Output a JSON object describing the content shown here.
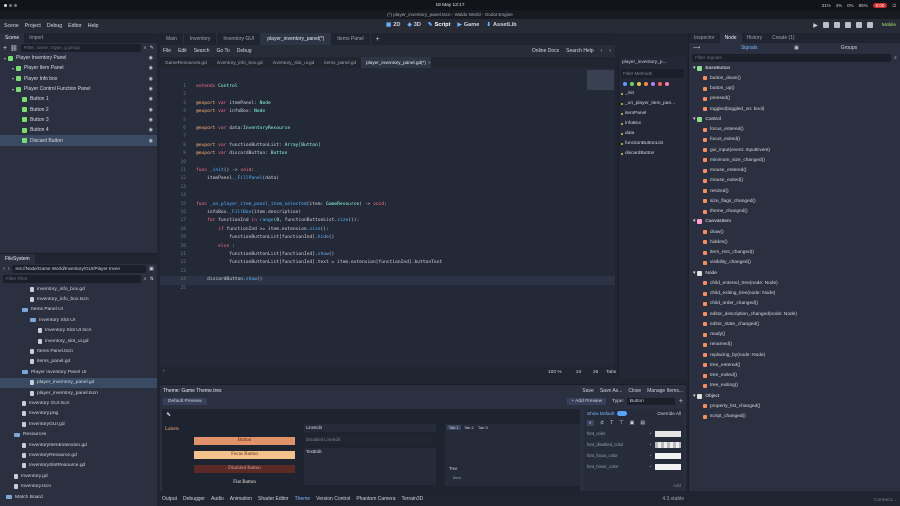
{
  "system": {
    "date_time": "18 May 13:17",
    "battery": "31%",
    "mem": "4%",
    "cpu": "0%",
    "vol": "85%",
    "rec": "0:00"
  },
  "window_title": "(*) player_inventory_panel.tscn - Waldo World - Godot Engine",
  "menu": [
    "Scene",
    "Project",
    "Debug",
    "Editor",
    "Help"
  ],
  "workspaces": [
    "2D",
    "3D",
    "Script",
    "Game",
    "AssetLib"
  ],
  "renderer": "Mobile",
  "scene_dock": {
    "tabs": [
      "Scene",
      "Import"
    ],
    "filter_placeholder": "Filter: name, t:type, g:group",
    "nodes": [
      {
        "label": "Player Inventory Panel",
        "color": "#79e06e",
        "indent": 0
      },
      {
        "label": "Player Item Panel",
        "color": "#79e06e",
        "indent": 1
      },
      {
        "label": "Player Info box",
        "color": "#79e06e",
        "indent": 1
      },
      {
        "label": "Player Control Function Panel",
        "color": "#79e06e",
        "indent": 1
      },
      {
        "label": "Button 1",
        "color": "#79e06e",
        "indent": 2
      },
      {
        "label": "Button 2",
        "color": "#79e06e",
        "indent": 2
      },
      {
        "label": "Button 3",
        "color": "#79e06e",
        "indent": 2
      },
      {
        "label": "Button 4",
        "color": "#79e06e",
        "indent": 2
      },
      {
        "label": "Discard Button",
        "color": "#79e06e",
        "indent": 2
      }
    ]
  },
  "filesystem": {
    "title": "FileSystem",
    "path": "res://Node/Game World/Inventory/GUI/Player Inven",
    "filter_placeholder": "Filter Files",
    "items": [
      {
        "label": "inventory_info_box.gd",
        "kind": "file",
        "indent": 3
      },
      {
        "label": "Inventory_info_box.tscn",
        "kind": "file",
        "indent": 3
      },
      {
        "label": "Items Panel UI",
        "kind": "folder",
        "indent": 2
      },
      {
        "label": "Inventory Slot UI",
        "kind": "folder",
        "indent": 3
      },
      {
        "label": "Inventory Slot UI.tscn",
        "kind": "file",
        "indent": 4
      },
      {
        "label": "inventory_slot_ui.gd",
        "kind": "file",
        "indent": 4
      },
      {
        "label": "Items Panel.tscn",
        "kind": "file",
        "indent": 3
      },
      {
        "label": "items_panel.gd",
        "kind": "file",
        "indent": 3
      },
      {
        "label": "Player Inventory Panel UI",
        "kind": "folder",
        "indent": 2
      },
      {
        "label": "player_inventory_panel.gd",
        "kind": "file",
        "indent": 3
      },
      {
        "label": "player_inventory_panel.tscn",
        "kind": "file",
        "indent": 3
      },
      {
        "label": "Inventory GUI.tscn",
        "kind": "file",
        "indent": 2
      },
      {
        "label": "Inventory.png",
        "kind": "file",
        "indent": 2
      },
      {
        "label": "InventoryGUI.gd",
        "kind": "file",
        "indent": 2
      },
      {
        "label": "Resources",
        "kind": "folder",
        "indent": 1
      },
      {
        "label": "InventoryItemExtension.gd",
        "kind": "file",
        "indent": 2
      },
      {
        "label": "InventoryResource.gd",
        "kind": "file",
        "indent": 2
      },
      {
        "label": "InventorySlotResource.gd",
        "kind": "file",
        "indent": 2
      },
      {
        "label": "Inventory.gd",
        "kind": "file",
        "indent": 1
      },
      {
        "label": "Inventory.tscn",
        "kind": "file",
        "indent": 1
      },
      {
        "label": "Match Board",
        "kind": "folder",
        "indent": 0
      }
    ]
  },
  "scene_tabs": [
    "Main",
    "Inventory",
    "Inventory GUI",
    "player_inventory_panel(*)",
    "Items Panel"
  ],
  "script_menu": [
    "File",
    "Edit",
    "Search",
    "Go To",
    "Debug"
  ],
  "script_right": [
    "Online Docs",
    "Search Help"
  ],
  "file_tabs": [
    "GameResources.gd",
    "inventory_info_box.gd",
    "inventory_slot_ui.gd",
    "items_panel.gd",
    "player_inventory_panel.gd(*)"
  ],
  "code": [
    {
      "n": "1",
      "t": "extends Control"
    },
    {
      "n": "2",
      "t": ""
    },
    {
      "n": "3",
      "t": "@export var itemPanel: Node"
    },
    {
      "n": "4",
      "t": "@export var infoBox: Node"
    },
    {
      "n": "5",
      "t": ""
    },
    {
      "n": "6",
      "t": "@export var data:InventoryResource"
    },
    {
      "n": "7",
      "t": ""
    },
    {
      "n": "8",
      "t": "@export var functionButtonList: Array[Button]"
    },
    {
      "n": "9",
      "t": "@export var discardButton: Button"
    },
    {
      "n": "10",
      "t": ""
    },
    {
      "n": "11",
      "t": "func _init() -> void:"
    },
    {
      "n": "12",
      "t": "    itemPanel._FillPanel(data)"
    },
    {
      "n": "13",
      "t": ""
    },
    {
      "n": "14",
      "t": ""
    },
    {
      "n": "15",
      "t": "func _on_player_item_panel_item_selected(item: GameResource) -> void:"
    },
    {
      "n": "16",
      "t": "    infoBox._FillBox(item.description)"
    },
    {
      "n": "17",
      "t": "    for functionInd in range(0, functionButtonList.size()):"
    },
    {
      "n": "18",
      "t": "        if functionInd >= item.extension.size():"
    },
    {
      "n": "19",
      "t": "            functionButtonList[functionInd].hide()"
    },
    {
      "n": "20",
      "t": "        else :"
    },
    {
      "n": "21",
      "t": "            functionButtonList[functionInd].show()"
    },
    {
      "n": "22",
      "t": "            functionButtonList[functionInd].text = item.extension[functionInd].buttonText"
    },
    {
      "n": "23",
      "t": ""
    },
    {
      "n": "24",
      "t": "    discardButton.show()"
    },
    {
      "n": "25",
      "t": ""
    }
  ],
  "status": {
    "zoom": "100 %",
    "line": "24",
    "col": "25",
    "indent": "Tabs"
  },
  "method_list": {
    "title": "player_inventory_p...",
    "filter": "Filter Methods",
    "items": [
      "_init",
      "_on_player_item_pan...",
      "itemPanel",
      "infoBox",
      "data",
      "functionButtonList",
      "discardButton"
    ]
  },
  "theme_editor": {
    "title": "Theme: Game Theme.tres",
    "actions": [
      "Save",
      "Save As...",
      "Close",
      "Manage Items..."
    ],
    "preview_tab": "Default Preview",
    "add_preview": "Add Preview",
    "type_label": "Type:",
    "type_value": "Button",
    "show_default": "Show Default",
    "override_all": "Override All",
    "preview_labels": [
      "Labels",
      "Button",
      "Focus Button",
      "Disabled Button",
      "Flat Button"
    ],
    "preview_fields": [
      "LineEdit",
      "Disabled LineEdit",
      "TextEdit"
    ],
    "preview_tabs": [
      "Tab 1",
      "Tab 2",
      "Tab 3"
    ],
    "tree_items": [
      "Tree",
      "Item"
    ],
    "props": [
      "font_color",
      "font_disabled_color",
      "font_focus_color",
      "font_hover_color"
    ],
    "add_label": "Add"
  },
  "bottom_tabs": [
    "Output",
    "Debugger",
    "Audio",
    "Animation",
    "Shader Editor",
    "Theme",
    "Version Control",
    "Phantom Camera",
    "Terrain3D"
  ],
  "version": "4.3.stable",
  "right_dock": {
    "tabs": [
      "Inspector",
      "Node",
      "History",
      "Create (1)"
    ],
    "subtabs": [
      "Signals",
      "Groups"
    ],
    "filter_placeholder": "Filter Signals",
    "groups": [
      {
        "head": "BaseButton",
        "color": "#8fe086",
        "items": [
          "button_down()",
          "button_up()",
          "pressed()",
          "toggled(toggled_on: bool)"
        ]
      },
      {
        "head": "Control",
        "color": "#8fe086",
        "items": [
          "focus_entered()",
          "focus_exited()",
          "gui_input(event: InputEvent)",
          "minimum_size_changed()",
          "mouse_entered()",
          "mouse_exited()",
          "resized()",
          "size_flags_changed()",
          "theme_changed()"
        ]
      },
      {
        "head": "CanvasItem",
        "color": "#ff9ed0",
        "items": [
          "draw()",
          "hidden()",
          "item_rect_changed()",
          "visibility_changed()"
        ]
      },
      {
        "head": "Node",
        "color": "#e0e0e0",
        "items": [
          "child_entered_tree(node: Node)",
          "child_exiting_tree(node: Node)",
          "child_order_changed()",
          "editor_description_changed(node: Node)",
          "editor_state_changed()",
          "ready()",
          "renamed()",
          "replacing_by(node: Node)",
          "tree_entered()",
          "tree_exited()",
          "tree_exiting()"
        ]
      },
      {
        "head": "Object",
        "color": "#e0e0e0",
        "items": [
          "property_list_changed()",
          "script_changed()"
        ]
      }
    ],
    "connect": "Connect..."
  }
}
